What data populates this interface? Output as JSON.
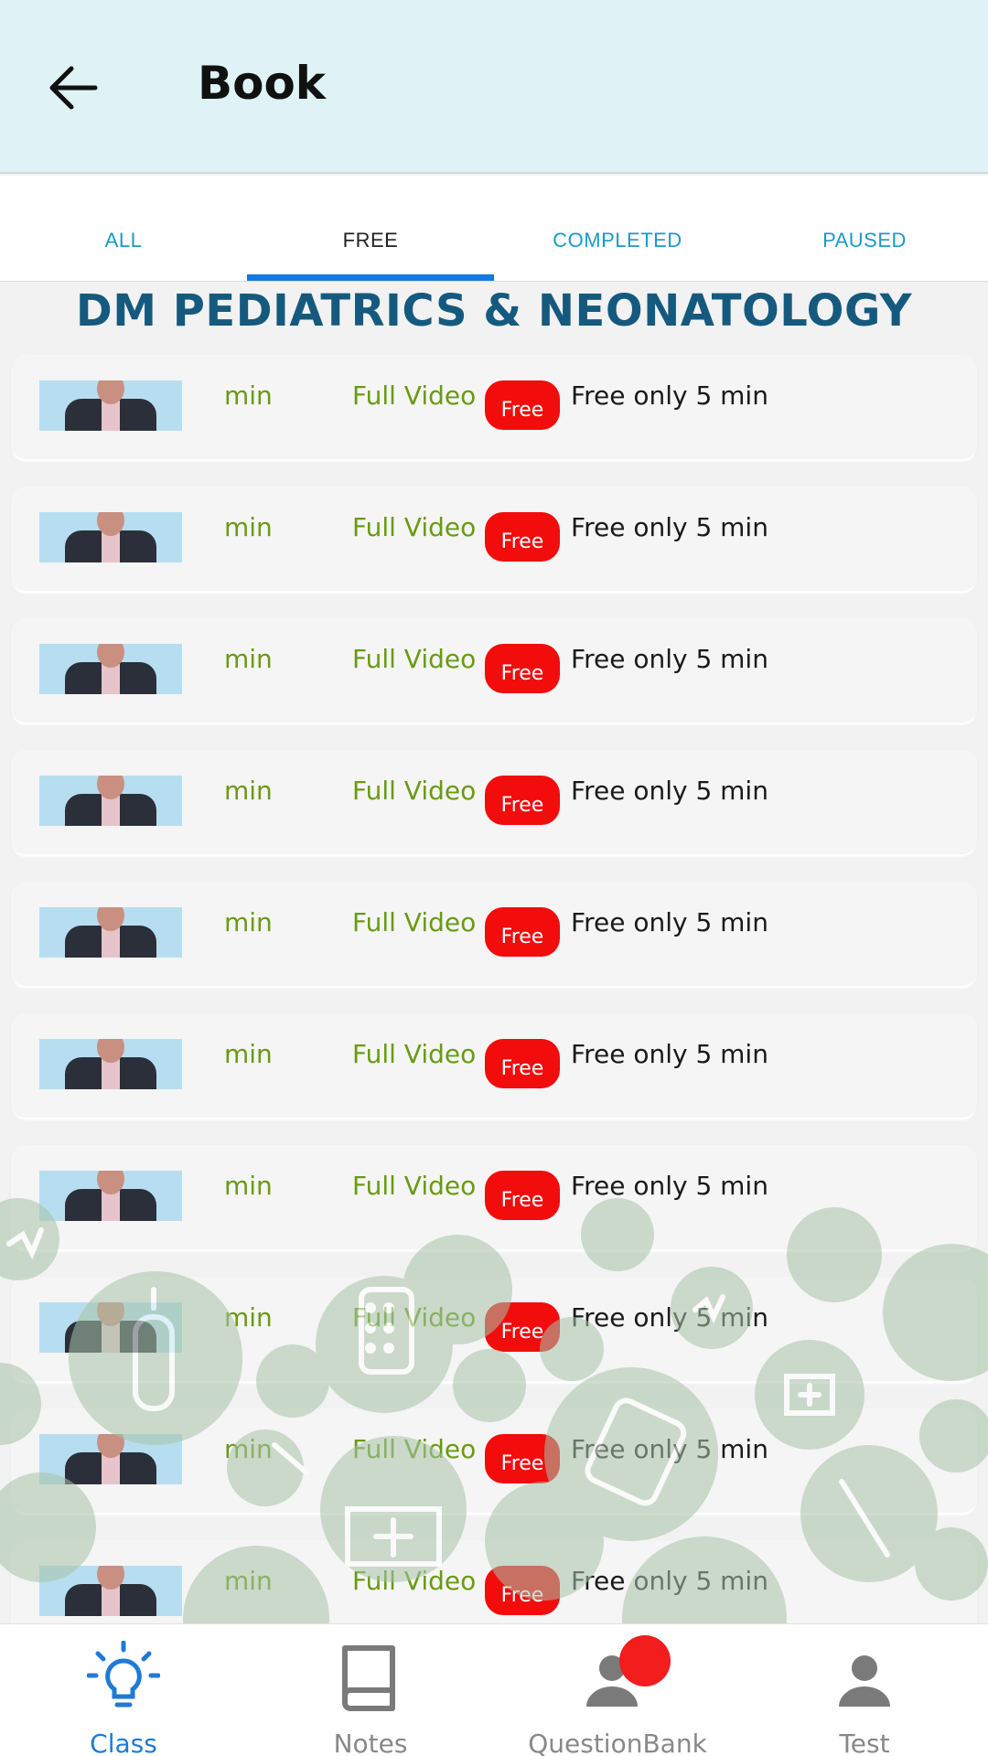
{
  "appbar": {
    "title": "Book",
    "back_icon": "arrow-left-icon"
  },
  "tabs": [
    {
      "label": "ALL",
      "active": false
    },
    {
      "label": "FREE",
      "active": true
    },
    {
      "label": "COMPLETED",
      "active": false
    },
    {
      "label": "PAUSED",
      "active": false
    }
  ],
  "section": {
    "title": "DM PEDIATRICS & NEONATOLOGY"
  },
  "lessons": [
    {
      "duration": "min",
      "type": "Full Video",
      "badge": "Free",
      "note": "Free only 5 min"
    },
    {
      "duration": "min",
      "type": "Full Video",
      "badge": "Free",
      "note": "Free only 5 min"
    },
    {
      "duration": "min",
      "type": "Full Video",
      "badge": "Free",
      "note": "Free only 5 min"
    },
    {
      "duration": "min",
      "type": "Full Video",
      "badge": "Free",
      "note": "Free only 5 min"
    },
    {
      "duration": "min",
      "type": "Full Video",
      "badge": "Free",
      "note": "Free only 5 min"
    },
    {
      "duration": "min",
      "type": "Full Video",
      "badge": "Free",
      "note": "Free only 5 min"
    },
    {
      "duration": "min",
      "type": "Full Video",
      "badge": "Free",
      "note": "Free only 5 min"
    },
    {
      "duration": "min",
      "type": "Full Video",
      "badge": "Free",
      "note": "Free only 5 min"
    },
    {
      "duration": "min",
      "type": "Full Video",
      "badge": "Free",
      "note": "Free only 5 min"
    },
    {
      "duration": "min",
      "type": "Full Video",
      "badge": "Free",
      "note": "Free only 5 min"
    }
  ],
  "bottom_nav": [
    {
      "label": "Class",
      "icon": "lightbulb-icon",
      "active": true
    },
    {
      "label": "Notes",
      "icon": "book-icon",
      "active": false
    },
    {
      "label": "QuestionBank",
      "icon": "person-icon",
      "active": false
    },
    {
      "label": "Test",
      "icon": "person-icon",
      "active": false
    }
  ],
  "colors": {
    "appbar_bg": "#dff3f6",
    "tab_accent": "#1678e0",
    "section_title": "#155a7e",
    "green_text": "#6a9a14",
    "badge_red": "#f20c0c",
    "nav_active": "#1e7ad6"
  }
}
